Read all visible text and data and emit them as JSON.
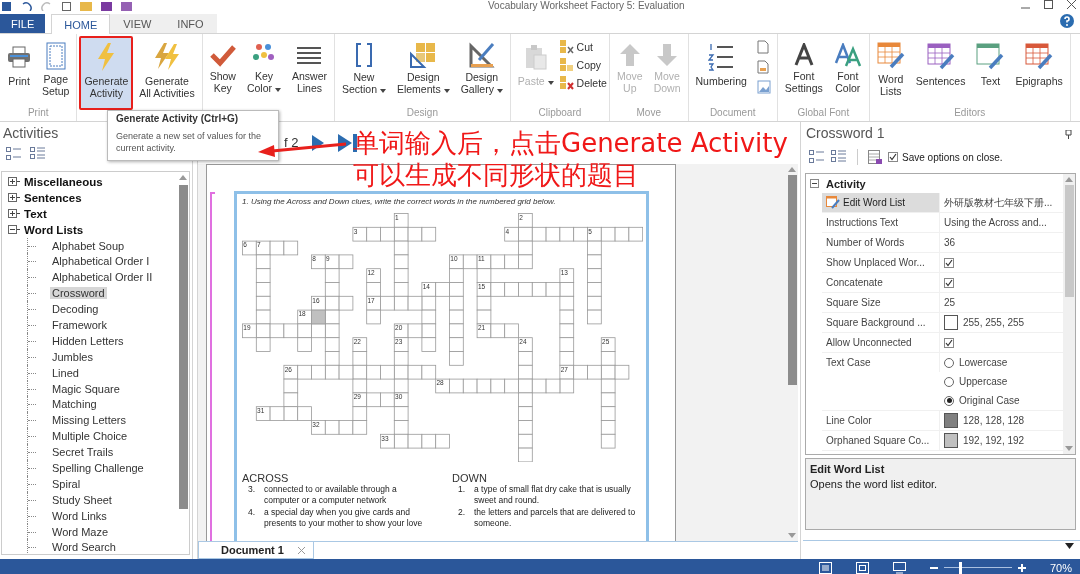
{
  "window": {
    "title": "Vocabulary Worksheet Factory 5: Evaluation"
  },
  "ribbon_tabs": [
    {
      "label": "FILE",
      "kind": "file",
      "selected": false
    },
    {
      "label": "HOME",
      "kind": "tab",
      "selected": true
    },
    {
      "label": "VIEW",
      "kind": "tab",
      "selected": false
    },
    {
      "label": "INFO",
      "kind": "tab",
      "selected": false
    }
  ],
  "ribbon_groups": [
    {
      "label": "Print",
      "buttons": [
        {
          "label": "Print",
          "kind": "large",
          "disabled": false,
          "dropdown": false,
          "hovered": false,
          "circled": false
        },
        {
          "label": "Page\nSetup",
          "kind": "large",
          "disabled": false,
          "dropdown": false,
          "hovered": false,
          "circled": false
        }
      ]
    },
    {
      "buttons": [
        {
          "label": "Generate\nActivity",
          "kind": "large",
          "disabled": false,
          "dropdown": false,
          "hovered": true,
          "circled": true
        },
        {
          "label": "Generate\nAll Activities",
          "kind": "large",
          "disabled": false,
          "dropdown": false,
          "hovered": false,
          "circled": false
        }
      ]
    },
    {
      "buttons": [
        {
          "label": "Show\nKey",
          "kind": "large",
          "disabled": false,
          "dropdown": false,
          "hovered": false,
          "circled": false
        },
        {
          "label": "Key\nColor",
          "kind": "large",
          "disabled": false,
          "dropdown": true,
          "hovered": false,
          "circled": false
        },
        {
          "label": "Answer\nLines",
          "kind": "large",
          "disabled": false,
          "dropdown": false,
          "hovered": false,
          "circled": false
        }
      ]
    },
    {
      "label": "Design",
      "buttons": [
        {
          "label": "New\nSection",
          "kind": "large",
          "disabled": false,
          "dropdown": true,
          "hovered": false,
          "circled": false
        },
        {
          "label": "Design\nElements",
          "kind": "large",
          "disabled": false,
          "dropdown": true,
          "hovered": false,
          "circled": false
        },
        {
          "label": "Design\nGallery",
          "kind": "large",
          "disabled": false,
          "dropdown": true,
          "hovered": false,
          "circled": false
        }
      ]
    },
    {
      "label": "Clipboard",
      "buttons": [
        {
          "label": "Paste",
          "kind": "large",
          "disabled": true,
          "dropdown": true,
          "hovered": false,
          "circled": false
        },
        {
          "label": "Cut",
          "kind": "small",
          "disabled": false,
          "dropdown": false,
          "hovered": false,
          "circled": false
        },
        {
          "label": "Copy",
          "kind": "small",
          "disabled": false,
          "dropdown": false,
          "hovered": false,
          "circled": false
        },
        {
          "label": "Delete",
          "kind": "small",
          "disabled": false,
          "dropdown": false,
          "hovered": false,
          "circled": false
        }
      ]
    },
    {
      "label": "Move",
      "buttons": [
        {
          "label": "Move\nUp",
          "kind": "large",
          "disabled": true,
          "dropdown": false,
          "hovered": false,
          "circled": false
        },
        {
          "label": "Move\nDown",
          "kind": "large",
          "disabled": true,
          "dropdown": false,
          "hovered": false,
          "circled": false
        }
      ]
    },
    {
      "label": "Document",
      "buttons": [
        {
          "label": "Numbering",
          "kind": "large",
          "disabled": false,
          "dropdown": false,
          "hovered": false,
          "circled": false
        },
        {
          "kind": "icon",
          "disabled": false,
          "dropdown": false,
          "hovered": false,
          "circled": false
        },
        {
          "kind": "icon",
          "disabled": false,
          "dropdown": false,
          "hovered": false,
          "circled": false
        },
        {
          "kind": "icon",
          "disabled": false,
          "dropdown": false,
          "hovered": false,
          "circled": false
        }
      ]
    },
    {
      "label": "Global Font",
      "buttons": [
        {
          "label": "Font\nSettings",
          "kind": "large",
          "disabled": false,
          "dropdown": false,
          "hovered": false,
          "circled": false
        },
        {
          "label": "Font\nColor",
          "kind": "large",
          "disabled": false,
          "dropdown": false,
          "hovered": false,
          "circled": false
        }
      ]
    },
    {
      "label": "Editors",
      "buttons": [
        {
          "label": "Word\nLists",
          "kind": "large",
          "disabled": false,
          "dropdown": false,
          "hovered": false,
          "circled": false
        },
        {
          "label": "Sentences",
          "kind": "large",
          "disabled": false,
          "dropdown": false,
          "hovered": false,
          "circled": false
        },
        {
          "label": "Text",
          "kind": "large",
          "disabled": false,
          "dropdown": false,
          "hovered": false,
          "circled": false
        },
        {
          "label": "Epigraphs",
          "kind": "large",
          "disabled": false,
          "dropdown": false,
          "hovered": false,
          "circled": false
        }
      ]
    }
  ],
  "tooltip": {
    "title": "Generate Activity (Ctrl+G)",
    "text": "Generate a new set of values for the current activity."
  },
  "annotation": {
    "lines": [
      "单词输入后，点击Generate Activity",
      "可以生成不同形状的题目"
    ]
  },
  "activities_panel": {
    "title": "Activities",
    "tree": [
      {
        "label": "Miscellaneous",
        "expanded": false
      },
      {
        "label": "Sentences",
        "expanded": false
      },
      {
        "label": "Text",
        "expanded": false
      },
      {
        "label": "Word Lists",
        "expanded": true,
        "children": [
          {
            "label": "Alphabet Soup",
            "selected": false
          },
          {
            "label": "Alphabetical Order I",
            "selected": false
          },
          {
            "label": "Alphabetical Order II",
            "selected": false
          },
          {
            "label": "Crossword",
            "selected": true
          },
          {
            "label": "Decoding",
            "selected": false
          },
          {
            "label": "Framework",
            "selected": false
          },
          {
            "label": "Hidden Letters",
            "selected": false
          },
          {
            "label": "Jumbles",
            "selected": false
          },
          {
            "label": "Lined",
            "selected": false
          },
          {
            "label": "Magic Square",
            "selected": false
          },
          {
            "label": "Matching",
            "selected": false
          },
          {
            "label": "Missing Letters",
            "selected": false
          },
          {
            "label": "Multiple Choice",
            "selected": false
          },
          {
            "label": "Secret Trails",
            "selected": false
          },
          {
            "label": "Spelling Challenge",
            "selected": false
          },
          {
            "label": "Spiral",
            "selected": false
          },
          {
            "label": "Study Sheet",
            "selected": false
          },
          {
            "label": "Word Links",
            "selected": false
          },
          {
            "label": "Word Maze",
            "selected": false
          },
          {
            "label": "Word Search",
            "selected": false
          }
        ]
      }
    ]
  },
  "page_navigator": {
    "text": "f 2"
  },
  "worksheet": {
    "instruction": "1.  Using the Across and Down clues, write the correct words in the numbered grid below.",
    "crossword": {
      "square_numbers": [
        "1",
        "2",
        "3",
        "4",
        "5",
        "6",
        "7",
        "8",
        "9",
        "10",
        "11",
        "12",
        "13",
        "14",
        "15",
        "16",
        "17",
        "18",
        "19",
        "20",
        "21",
        "22",
        "23",
        "24",
        "25",
        "26",
        "27",
        "28",
        "29",
        "30",
        "31",
        "32",
        "33"
      ]
    },
    "clue_sections": [
      {
        "title": "ACROSS",
        "clues": [
          {
            "number": "3.",
            "text": "connected to or available through a computer or a computer network"
          },
          {
            "number": "4.",
            "text": "a special day when you give cards and presents to your mother to show your love"
          }
        ]
      },
      {
        "title": "DOWN",
        "clues": [
          {
            "number": "1.",
            "text": "a type of small flat dry cake that is usually sweet and round."
          },
          {
            "number": "2.",
            "text": "the letters and parcels that are delivered to someone."
          }
        ]
      }
    ]
  },
  "document_tabs": [
    {
      "label": "Document 1",
      "selected": true
    }
  ],
  "options_panel": {
    "title": "Crossword 1",
    "save_option": {
      "label": "Save options on close.",
      "checked": true
    },
    "category": {
      "label": "Activity",
      "expanded": true
    },
    "properties": [
      {
        "label": "Edit Word List",
        "kind": "editor",
        "selected": true,
        "value": "外研版教材七年级下册..."
      },
      {
        "label": "Instructions Text",
        "kind": "text",
        "selected": false,
        "value": "Using the Across and..."
      },
      {
        "label": "Number of Words",
        "kind": "text",
        "selected": false,
        "value": "36"
      },
      {
        "label": "Show Unplaced Wor...",
        "kind": "checkbox",
        "selected": false,
        "checked": true
      },
      {
        "label": "Concatenate",
        "kind": "checkbox",
        "selected": false,
        "checked": true
      },
      {
        "label": "Square Size",
        "kind": "text",
        "selected": false,
        "value": "25"
      },
      {
        "label": "Square Background ...",
        "kind": "color",
        "selected": false,
        "color": "#ffffff",
        "value": "255, 255, 255"
      },
      {
        "label": "Allow Unconnected",
        "kind": "checkbox",
        "selected": false,
        "checked": true
      },
      {
        "label": "Text Case",
        "kind": "radio",
        "selected": false,
        "options": [
          {
            "label": "Lowercase",
            "selected": false
          },
          {
            "label": "Uppercase",
            "selected": false
          },
          {
            "label": "Original Case",
            "selected": true
          }
        ]
      },
      {
        "label": "Line Color",
        "kind": "color",
        "selected": false,
        "color": "#808080",
        "value": "128, 128, 128"
      },
      {
        "label": "Orphaned Square Co...",
        "kind": "color",
        "selected": false,
        "color": "#c0c0c0",
        "value": "192, 192, 192"
      }
    ],
    "description": {
      "title": "Edit Word List",
      "text": "Opens the word list editor."
    }
  },
  "status_bar": {
    "zoom": {
      "level": 0.25,
      "reading": "70%"
    }
  }
}
